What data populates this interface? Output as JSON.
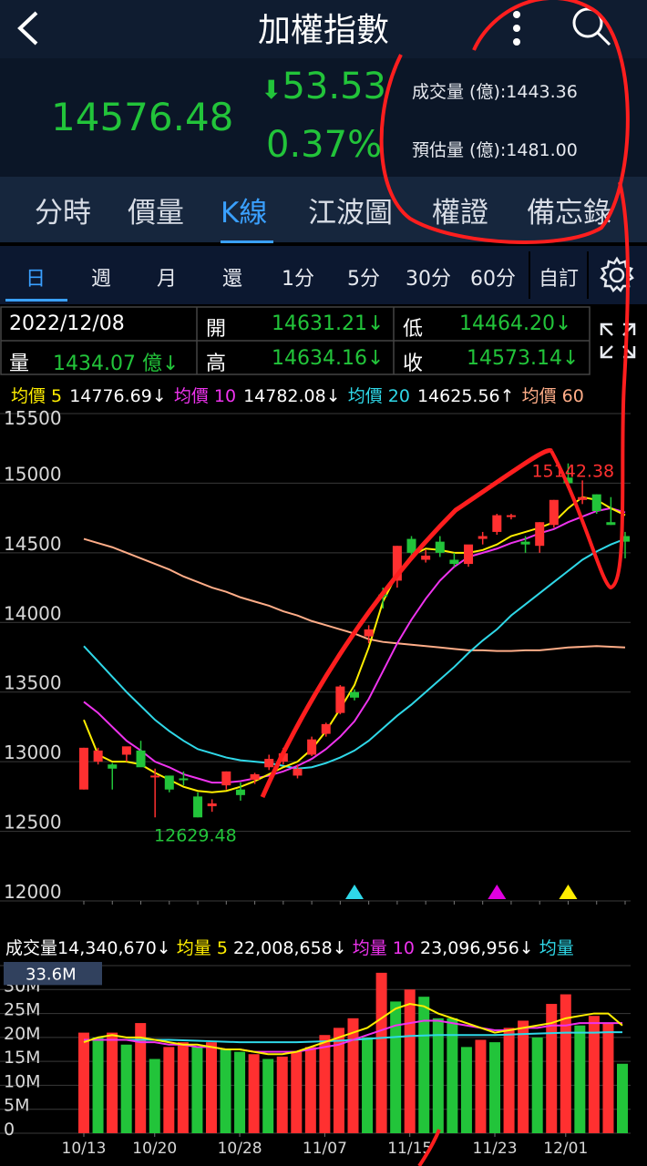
{
  "header": {
    "title": "加權指數",
    "back_icon": "chevron-left-icon",
    "more_icon": "more-vertical-icon",
    "search_icon": "search-icon"
  },
  "quote": {
    "price": "14576.48",
    "change": "53.53",
    "change_pct": "0.37%",
    "volume_label": "成交量 (億):1443.36",
    "est_volume_label": "預估量 (億):1481.00",
    "colors": {
      "up": "#ff3030",
      "down": "#22c43a"
    }
  },
  "tabs": [
    "分時",
    "價量",
    "K線",
    "江波圖",
    "權證",
    "備忘錄"
  ],
  "active_tab": "K線",
  "periods": [
    "日",
    "週",
    "月",
    "還",
    "1分",
    "5分",
    "30分",
    "60分",
    "自訂"
  ],
  "active_period": "日",
  "ohlc": {
    "date": "2022/12/08",
    "open_label": "開",
    "open": "14631.21↓",
    "low_label": "低",
    "low": "14464.20↓",
    "vol_label": "量",
    "vol": "1434.07 億↓",
    "high_label": "高",
    "high": "14634.16↓",
    "close_label": "收",
    "close": "14573.14↓"
  },
  "ma": {
    "ma5_label": "均價 5",
    "ma5": "14776.69↓",
    "ma10_label": "均價 10",
    "ma10": "14782.08↓",
    "ma20_label": "均價 20",
    "ma20": "14625.56↑",
    "ma60_label": "均價 60"
  },
  "vol_header": {
    "label": "成交量",
    "value": "14,340,670↓",
    "v5_label": "均量 5",
    "v5": "22,008,658↓",
    "v10_label": "均量 10",
    "v10": "23,096,956↓",
    "v20_label": "均量"
  },
  "chart_data": {
    "type": "candlestick",
    "y_ticks": [
      "15500",
      "15000",
      "14500",
      "14000",
      "13500",
      "13000",
      "12500",
      "12000"
    ],
    "ylim": [
      12000,
      15500
    ],
    "annotations": {
      "high": "15142.38",
      "low": "12629.48"
    },
    "x_labels": [
      "10/13",
      "10/20",
      "10/28",
      "11/07",
      "11/15",
      "11/23",
      "12/01"
    ],
    "candles": [
      [
        12800,
        13100,
        12800,
        13100,
        "up"
      ],
      [
        13000,
        13100,
        12980,
        13080,
        "up"
      ],
      [
        12950,
        12990,
        12800,
        12980,
        "down"
      ],
      [
        13050,
        13100,
        13000,
        13110,
        "up"
      ],
      [
        13080,
        13150,
        12980,
        12960,
        "down"
      ],
      [
        12900,
        12950,
        12600,
        12900,
        "up"
      ],
      [
        12800,
        12900,
        12780,
        12900,
        "down"
      ],
      [
        12880,
        12930,
        12830,
        12870,
        "down"
      ],
      [
        12750,
        12780,
        12600,
        12600,
        "down"
      ],
      [
        12680,
        12730,
        12640,
        12700,
        "up"
      ],
      [
        12830,
        12930,
        12800,
        12930,
        "up"
      ],
      [
        12800,
        12850,
        12720,
        12760,
        "down"
      ],
      [
        12870,
        12920,
        12840,
        12910,
        "up"
      ],
      [
        12960,
        13050,
        12940,
        13020,
        "up"
      ],
      [
        13000,
        13100,
        12980,
        13060,
        "up"
      ],
      [
        12900,
        12980,
        12880,
        12950,
        "up"
      ],
      [
        13050,
        13180,
        13040,
        13160,
        "up"
      ],
      [
        13200,
        13280,
        13180,
        13270,
        "up"
      ],
      [
        13350,
        13550,
        13340,
        13540,
        "up"
      ],
      [
        13500,
        13520,
        13440,
        13460,
        "down"
      ],
      [
        13900,
        13980,
        13850,
        13950,
        "up"
      ],
      [
        14200,
        14250,
        14100,
        14200,
        "down"
      ],
      [
        14300,
        14550,
        14250,
        14550,
        "up"
      ],
      [
        14500,
        14620,
        14480,
        14600,
        "down"
      ],
      [
        14450,
        14520,
        14430,
        14480,
        "up"
      ],
      [
        14500,
        14620,
        14470,
        14580,
        "down"
      ],
      [
        14450,
        14500,
        14400,
        14420,
        "down"
      ],
      [
        14420,
        14550,
        14400,
        14560,
        "up"
      ],
      [
        14600,
        14650,
        14560,
        14620,
        "up"
      ],
      [
        14650,
        14780,
        14630,
        14770,
        "up"
      ],
      [
        14760,
        14780,
        14740,
        14770,
        "up"
      ],
      [
        14580,
        14620,
        14500,
        14560,
        "down"
      ],
      [
        14550,
        14720,
        14500,
        14720,
        "up"
      ],
      [
        14700,
        14880,
        14680,
        14880,
        "up"
      ],
      [
        15040,
        15142,
        15000,
        15000,
        "down"
      ],
      [
        14900,
        15020,
        14850,
        14880,
        "up"
      ],
      [
        14800,
        14920,
        14780,
        14920,
        "down"
      ],
      [
        14720,
        14900,
        14700,
        14700,
        "down"
      ],
      [
        14620,
        14650,
        14460,
        14580,
        "down"
      ]
    ],
    "ma5": [
      13300,
      13050,
      13000,
      13000,
      12980,
      12920,
      12870,
      12820,
      12790,
      12780,
      12790,
      12820,
      12860,
      12910,
      12960,
      13000,
      13090,
      13220,
      13380,
      13550,
      13820,
      14150,
      14350,
      14480,
      14530,
      14520,
      14500,
      14500,
      14520,
      14560,
      14620,
      14650,
      14680,
      14720,
      14820,
      14900,
      14880,
      14820,
      14770
    ],
    "ma10": [
      13430,
      13350,
      13250,
      13150,
      13080,
      13000,
      12960,
      12910,
      12880,
      12850,
      12850,
      12860,
      12880,
      12900,
      12930,
      12970,
      13020,
      13090,
      13180,
      13290,
      13450,
      13650,
      13850,
      14020,
      14170,
      14300,
      14400,
      14470,
      14500,
      14530,
      14570,
      14600,
      14640,
      14670,
      14720,
      14760,
      14800,
      14820,
      14790
    ],
    "ma20": [
      13830,
      13720,
      13610,
      13500,
      13400,
      13300,
      13220,
      13150,
      13090,
      13060,
      13030,
      13010,
      13000,
      12990,
      12970,
      12950,
      12960,
      12990,
      13030,
      13080,
      13150,
      13240,
      13330,
      13410,
      13500,
      13590,
      13680,
      13780,
      13870,
      13950,
      14050,
      14130,
      14210,
      14290,
      14370,
      14450,
      14510,
      14560,
      14600
    ],
    "ma60": [
      14600,
      14570,
      14540,
      14500,
      14460,
      14420,
      14380,
      14330,
      14290,
      14250,
      14220,
      14180,
      14150,
      14120,
      14080,
      14050,
      14010,
      13980,
      13950,
      13920,
      13880,
      13860,
      13850,
      13840,
      13830,
      13820,
      13810,
      13800,
      13800,
      13795,
      13795,
      13800,
      13800,
      13810,
      13820,
      13825,
      13830,
      13825,
      13820
    ],
    "colors": {
      "ma5": "#ffee00",
      "ma10": "#ee33ee",
      "ma20": "#2fd8e8",
      "ma60": "#ffad88"
    },
    "markers": [
      {
        "index": 19,
        "color": "#2fd8e8"
      },
      {
        "index": 29,
        "color": "#e000e0"
      },
      {
        "index": 34,
        "color": "#ffee00"
      }
    ]
  },
  "volume_chart": {
    "y_ticks": [
      "35M",
      "30M",
      "25M",
      "20M",
      "15M",
      "10M",
      "5M",
      "0"
    ],
    "ylim": [
      0,
      35
    ],
    "cursor_value": "33.6M",
    "bars": [
      [
        21,
        "up"
      ],
      [
        20,
        "down"
      ],
      [
        21,
        "up"
      ],
      [
        18.5,
        "down"
      ],
      [
        23,
        "up"
      ],
      [
        15.5,
        "down"
      ],
      [
        18,
        "up"
      ],
      [
        19,
        "up"
      ],
      [
        18,
        "down"
      ],
      [
        19,
        "up"
      ],
      [
        17.5,
        "down"
      ],
      [
        17,
        "down"
      ],
      [
        16.5,
        "up"
      ],
      [
        15.5,
        "down"
      ],
      [
        16,
        "up"
      ],
      [
        17,
        "up"
      ],
      [
        18,
        "up"
      ],
      [
        20.5,
        "up"
      ],
      [
        22,
        "up"
      ],
      [
        24,
        "up"
      ],
      [
        20,
        "down"
      ],
      [
        33.5,
        "up"
      ],
      [
        27.5,
        "down"
      ],
      [
        30,
        "up"
      ],
      [
        28.5,
        "down"
      ],
      [
        24,
        "down"
      ],
      [
        24,
        "down"
      ],
      [
        18,
        "down"
      ],
      [
        19.5,
        "up"
      ],
      [
        19,
        "down"
      ],
      [
        22,
        "up"
      ],
      [
        23.5,
        "up"
      ],
      [
        20,
        "down"
      ],
      [
        27,
        "up"
      ],
      [
        29,
        "up"
      ],
      [
        22.5,
        "down"
      ],
      [
        24.5,
        "up"
      ],
      [
        23,
        "up"
      ],
      [
        14.5,
        "down"
      ]
    ],
    "v5": [
      19,
      20,
      20.5,
      20,
      20,
      19.5,
      19,
      18.5,
      18.5,
      18,
      17.5,
      17.5,
      17,
      16.5,
      16.5,
      17,
      18,
      19,
      20,
      21,
      22,
      24,
      26,
      27,
      26.5,
      25,
      24,
      23,
      22,
      21,
      21.5,
      22,
      22.5,
      23,
      24,
      24.5,
      25,
      25,
      22.5
    ],
    "v10": [
      19.5,
      19.5,
      19.5,
      19.5,
      19,
      19,
      18.5,
      18.5,
      18,
      18,
      17.5,
      17.5,
      17,
      17,
      17,
      17,
      17.5,
      18,
      18.5,
      19.5,
      20.5,
      21.5,
      22.5,
      23,
      23.5,
      23.5,
      23,
      22.5,
      22,
      21.5,
      21.5,
      22,
      22,
      22.5,
      22.5,
      23,
      23,
      23,
      23
    ],
    "v20": [
      19.5,
      19.5,
      19.5,
      19.5,
      19.5,
      19.5,
      19.5,
      19.4,
      19.3,
      19.2,
      19.1,
      19,
      19,
      19,
      19,
      19,
      19.1,
      19.2,
      19.3,
      19.5,
      19.7,
      19.9,
      20.1,
      20.3,
      20.4,
      20.5,
      20.5,
      20.5,
      20.5,
      20.5,
      20.6,
      20.7,
      20.8,
      20.9,
      21,
      21,
      21,
      21.1,
      21.1
    ]
  }
}
